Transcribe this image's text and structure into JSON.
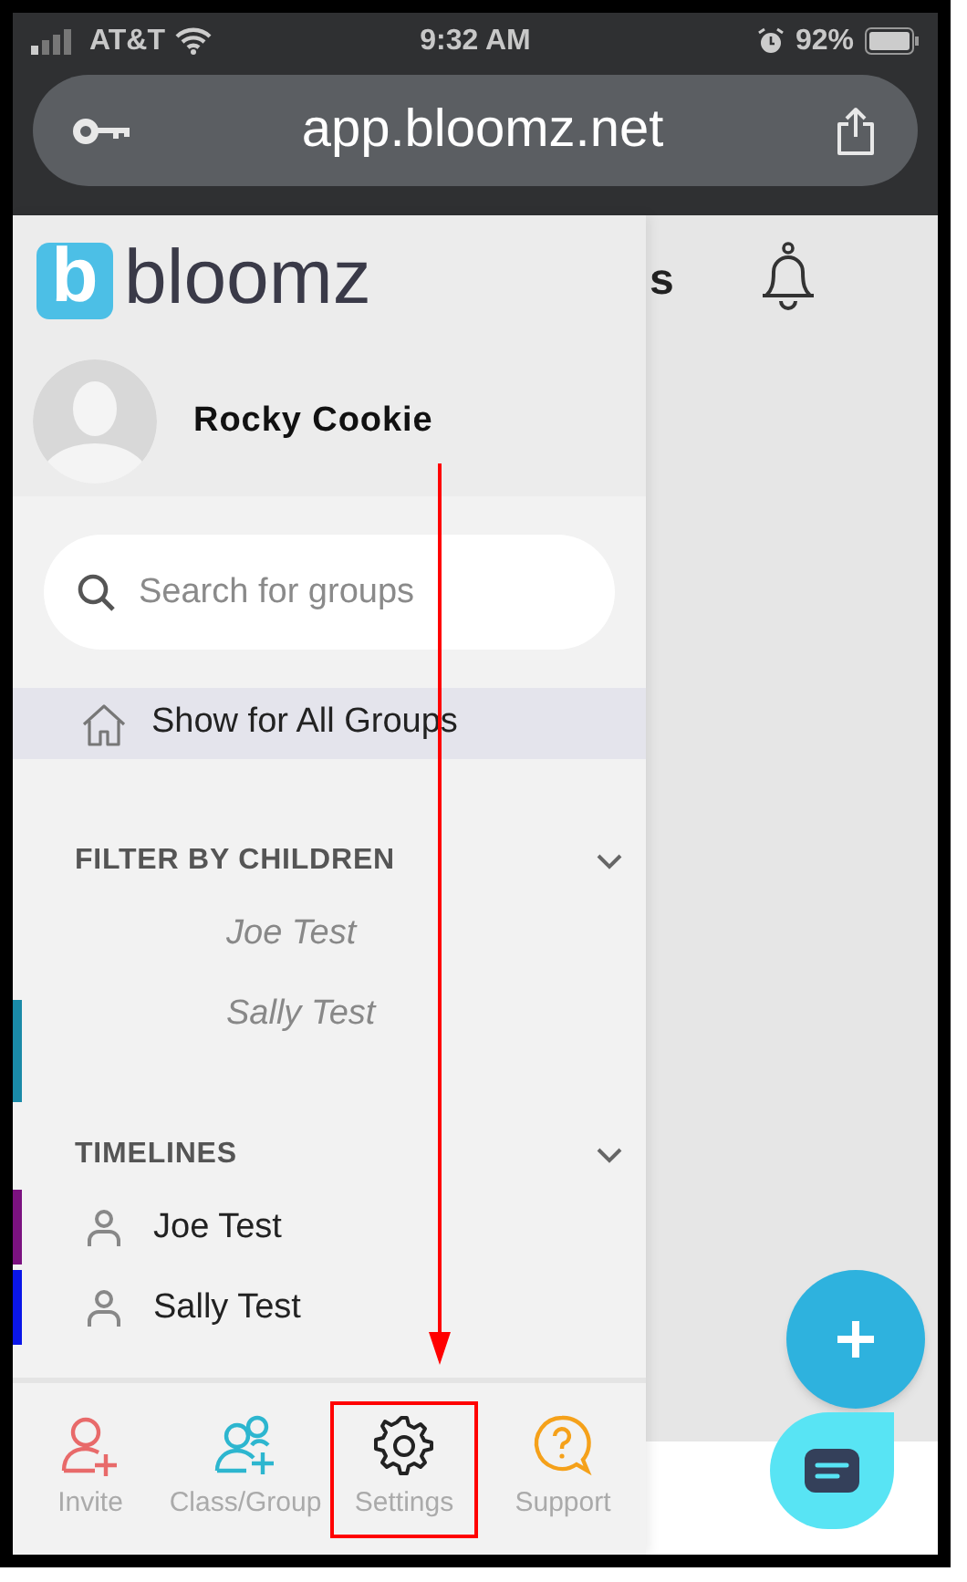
{
  "status_bar": {
    "carrier": "AT&T",
    "time": "9:32 AM",
    "battery": "92%"
  },
  "address_bar": {
    "url": "app.bloomz.net"
  },
  "background_page": {
    "title_fragment": "s"
  },
  "drawer": {
    "logo": {
      "mark": "b",
      "wordmark": "bloomz"
    },
    "profile": {
      "name": "Rocky Cookie"
    },
    "search": {
      "placeholder": "Search for groups"
    },
    "show_all": {
      "label": "Show for All Groups",
      "selected": true
    },
    "sections": [
      {
        "title": "FILTER BY CHILDREN",
        "kind": "filter",
        "expanded": true,
        "items": [
          {
            "label": "Joe Test"
          },
          {
            "label": "Sally Test",
            "color": "#1a8aa8"
          }
        ]
      },
      {
        "title": "TIMELINES",
        "kind": "timeline",
        "expanded": true,
        "items": [
          {
            "label": "Joe Test",
            "color": "#7b1280"
          },
          {
            "label": "Sally Test",
            "color": "#0a16e8"
          }
        ]
      }
    ],
    "bottom_nav": [
      {
        "label": "Invite",
        "kind": "invite",
        "highlighted": false
      },
      {
        "label": "Class/Group",
        "kind": "group",
        "highlighted": false
      },
      {
        "label": "Settings",
        "kind": "settings",
        "highlighted": true
      },
      {
        "label": "Support",
        "kind": "support",
        "highlighted": false
      }
    ]
  },
  "annotation_arrow": true
}
